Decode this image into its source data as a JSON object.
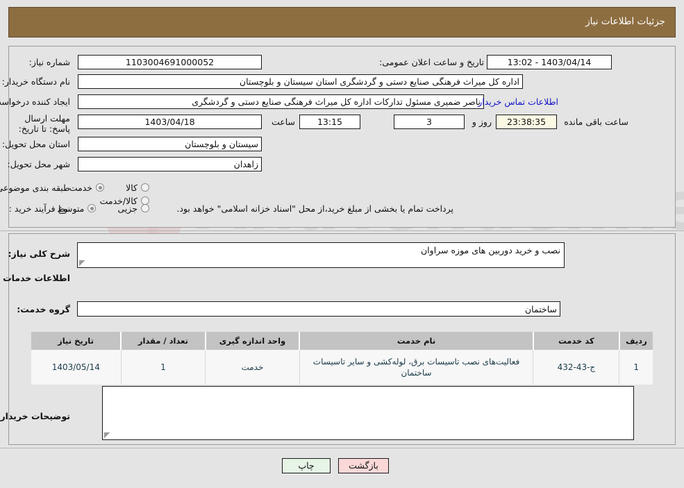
{
  "header": {
    "title": "جزئیات اطلاعات نیاز"
  },
  "form": {
    "need_number_label": "شماره نیاز:",
    "need_number_value": "1103004691000052",
    "announce_label": "تاریخ و ساعت اعلان عمومی:",
    "announce_value": "1403/04/14 - 13:02",
    "buyer_org_label": "نام دستگاه خریدار:",
    "buyer_org_value": "اداره کل میراث فرهنگی  صنایع دستی و گردشگری استان سیستان و بلوچستان",
    "requester_label": "ایجاد کننده درخواست:",
    "requester_value": "ناصر ضمیری مسئول تدارکات اداره کل میراث فرهنگی  صنایع دستی و گردشگری",
    "contact_link": "اطلاعات تماس خریدار",
    "deadline_label": "مهلت ارسال پاسخ: تا تاریخ:",
    "deadline_date": "1403/04/18",
    "hour_label": "ساعت",
    "deadline_time": "13:15",
    "days_value": "3",
    "days_label": "روز و",
    "countdown_value": "23:38:35",
    "remaining_label": "ساعت باقی مانده",
    "province_label": "استان محل تحویل:",
    "province_value": "سیستان و بلوچستان",
    "city_label": "شهر محل تحویل:",
    "city_value": "زاهدان",
    "category_label": "طبقه بندی موضوعی:",
    "category_options": [
      {
        "label": "کالا",
        "selected": false
      },
      {
        "label": "خدمت",
        "selected": true
      },
      {
        "label": "کالا/خدمت",
        "selected": false
      }
    ],
    "process_label": "نوع فرآیند خرید :",
    "process_options": [
      {
        "label": "جزیی",
        "selected": false
      },
      {
        "label": "متوسط",
        "selected": true
      }
    ],
    "payment_note": "پرداخت تمام یا بخشی از مبلغ خرید،از محل \"اسناد خزانه اسلامی\" خواهد بود."
  },
  "main": {
    "general_desc_label": "شرح کلی نیاز:",
    "general_desc_value": "نصب و خرید دوربین های موزه سراوان",
    "services_heading": "اطلاعات خدمات مورد نیاز",
    "service_group_label": "گروه خدمت:",
    "service_group_value": "ساختمان",
    "buyer_notes_label": "توضیحات خریدار:",
    "buyer_notes_value": ""
  },
  "table": {
    "headers": [
      "ردیف",
      "کد خدمت",
      "نام خدمت",
      "واحد اندازه گیری",
      "تعداد / مقدار",
      "تاریخ نیاز"
    ],
    "rows": [
      {
        "index": "1",
        "code": "ج-43-432",
        "name": "فعالیت‌های نصب تاسیسات برق، لوله‌کشی و سایر تاسیسات ساختمان",
        "unit": "خدمت",
        "quantity": "1",
        "need_date": "1403/05/14"
      }
    ]
  },
  "buttons": {
    "print": "چاپ",
    "back": "بازگشت"
  },
  "colors": {
    "header_bg": "#8d6e41",
    "link": "#1515c8",
    "table_header_bg": "#c3c3c3",
    "print_btn_bg": "#e6f5e6",
    "back_btn_bg": "#fbd8d8",
    "countdown_bg": "#fbf8e3"
  }
}
